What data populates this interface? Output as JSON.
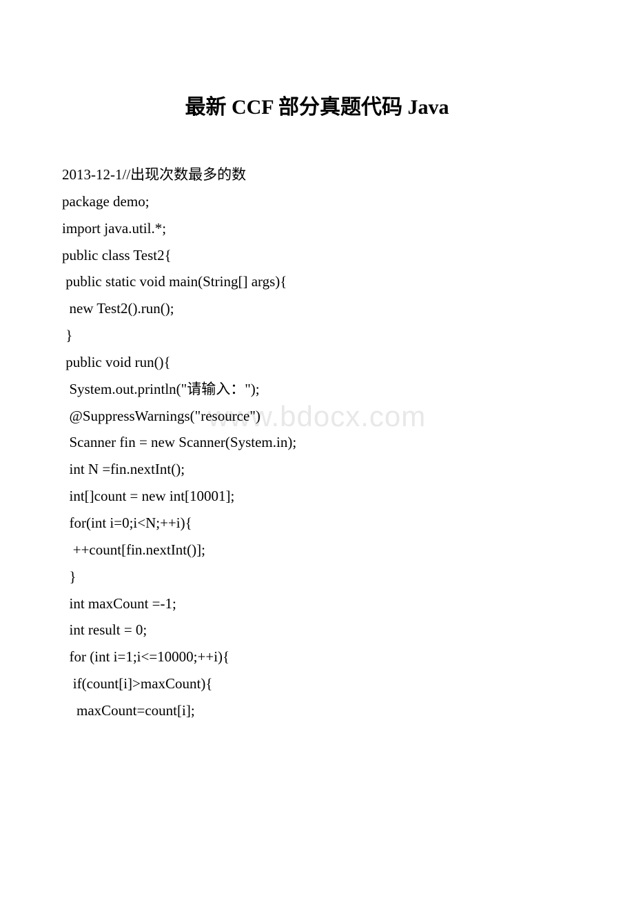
{
  "title": "最新 CCF 部分真题代码 Java",
  "watermark": "www.bdocx.com",
  "code_lines": [
    "2013-12-1//出现次数最多的数",
    "package demo;",
    "import java.util.*;",
    "public class Test2{",
    " public static void main(String[] args){",
    "  new Test2().run();",
    " }",
    " public void run(){",
    "",
    "  System.out.println(\"请输入：\");",
    "  @SuppressWarnings(\"resource\")",
    "  Scanner fin = new Scanner(System.in);",
    "",
    "  int N =fin.nextInt();",
    "  int[]count = new int[10001];",
    "  for(int i=0;i<N;++i){",
    "   ++count[fin.nextInt()];",
    "  }",
    "  int maxCount =-1;",
    "  int result = 0;",
    "  for (int i=1;i<=10000;++i){",
    "   if(count[i]>maxCount){",
    "    maxCount=count[i];"
  ]
}
